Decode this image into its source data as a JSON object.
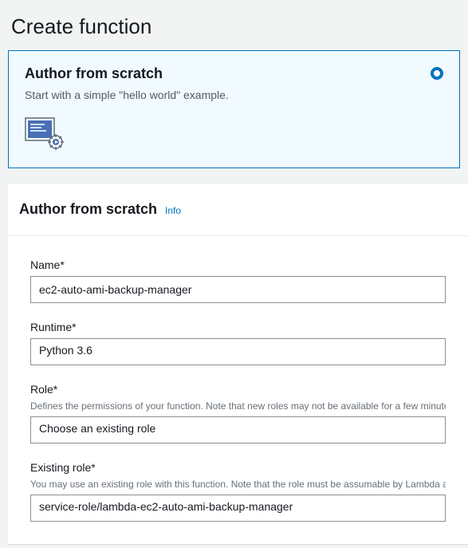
{
  "page_title": "Create function",
  "option": {
    "title": "Author from scratch",
    "desc": "Start with a simple \"hello world\" example.",
    "selected": true
  },
  "form": {
    "header": "Author from scratch",
    "info_label": "Info",
    "fields": {
      "name": {
        "label": "Name*",
        "value": "ec2-auto-ami-backup-manager"
      },
      "runtime": {
        "label": "Runtime*",
        "value": "Python 3.6"
      },
      "role": {
        "label": "Role*",
        "help": "Defines the permissions of your function. Note that new roles may not be available for a few minutes after creation.",
        "value": "Choose an existing role"
      },
      "existing_role": {
        "label": "Existing role*",
        "help": "You may use an existing role with this function. Note that the role must be assumable by Lambda and must have Cloudwatch Logs permissions.",
        "value": "service-role/lambda-ec2-auto-ami-backup-manager"
      }
    }
  }
}
